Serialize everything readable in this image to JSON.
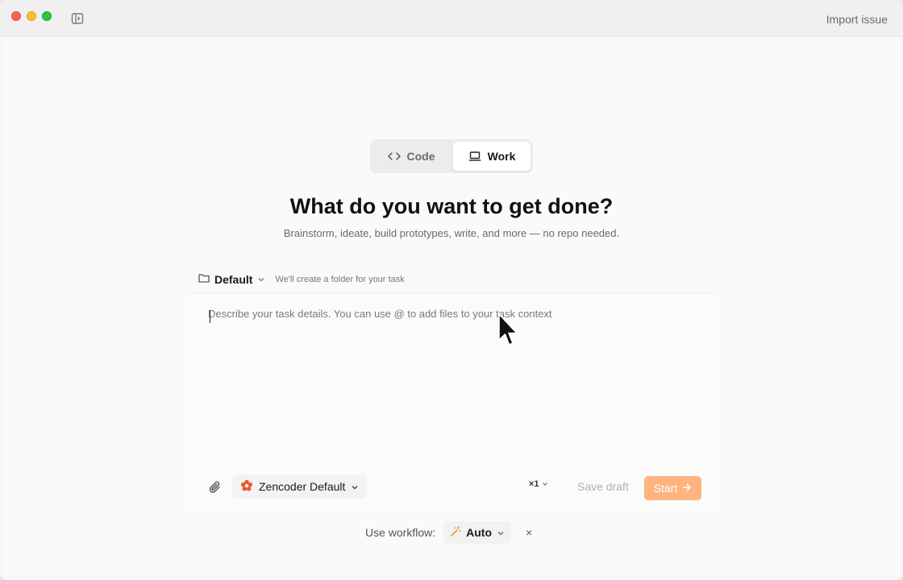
{
  "titlebar": {
    "import_label": "Import issue"
  },
  "mode_toggle": {
    "items": [
      {
        "label": "Code",
        "icon": "code-brackets-icon",
        "active": false
      },
      {
        "label": "Work",
        "icon": "laptop-icon",
        "active": true
      }
    ]
  },
  "hero": {
    "title": "What do you want to get done?",
    "subtitle": "Brainstorm, ideate, build prototypes, write, and more — no repo needed."
  },
  "task_card": {
    "folder_label": "Default",
    "folder_hint": "We'll create a folder for your task",
    "placeholder": "Describe your task details. You can use @ to add files to your task context",
    "value": "",
    "model_label": "Zencoder Default",
    "multiplier": "×1",
    "save_draft_label": "Save draft",
    "start_label": "Start"
  },
  "workflow": {
    "prefix": "Use workflow:",
    "value": "Auto",
    "close_glyph": "×"
  },
  "colors": {
    "accent": "#ffb37e",
    "brand_orange": "#e9582a"
  }
}
